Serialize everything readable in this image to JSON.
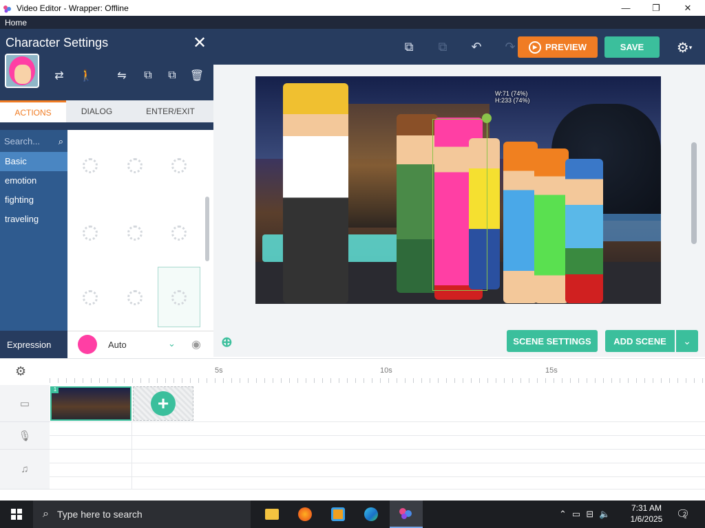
{
  "window": {
    "title": "Video Editor - Wrapper: Offline",
    "minimize": "—",
    "maximize": "❐",
    "close": "✕"
  },
  "menu": {
    "home": "Home"
  },
  "toolbar": {
    "preview_label": "PREVIEW",
    "save_label": "SAVE"
  },
  "panel": {
    "title": "Character Settings",
    "tabs": [
      "ACTIONS",
      "DIALOG",
      "ENTER/EXIT"
    ],
    "search_placeholder": "Search...",
    "categories": [
      "Basic",
      "emotion",
      "fighting",
      "traveling"
    ],
    "expression_label": "Expression",
    "expression_value": "Auto"
  },
  "stage": {
    "selection_label_w": "W:71 (74%)",
    "selection_label_h": "H:233 (74%)"
  },
  "scene_buttons": {
    "scene_settings": "SCENE SETTINGS",
    "add_scene": "ADD SCENE"
  },
  "timeline": {
    "ticks": [
      "5s",
      "10s",
      "15s"
    ],
    "scene_number": "1"
  },
  "taskbar": {
    "search_placeholder": "Type here to search",
    "time": "7:31 AM",
    "date": "1/6/2025",
    "notification_count": "2"
  },
  "colors": {
    "accent_teal": "#3bbf9c",
    "accent_orange": "#f07c24",
    "panel_navy": "#273c5f",
    "category_blue": "#2f5b8f"
  }
}
